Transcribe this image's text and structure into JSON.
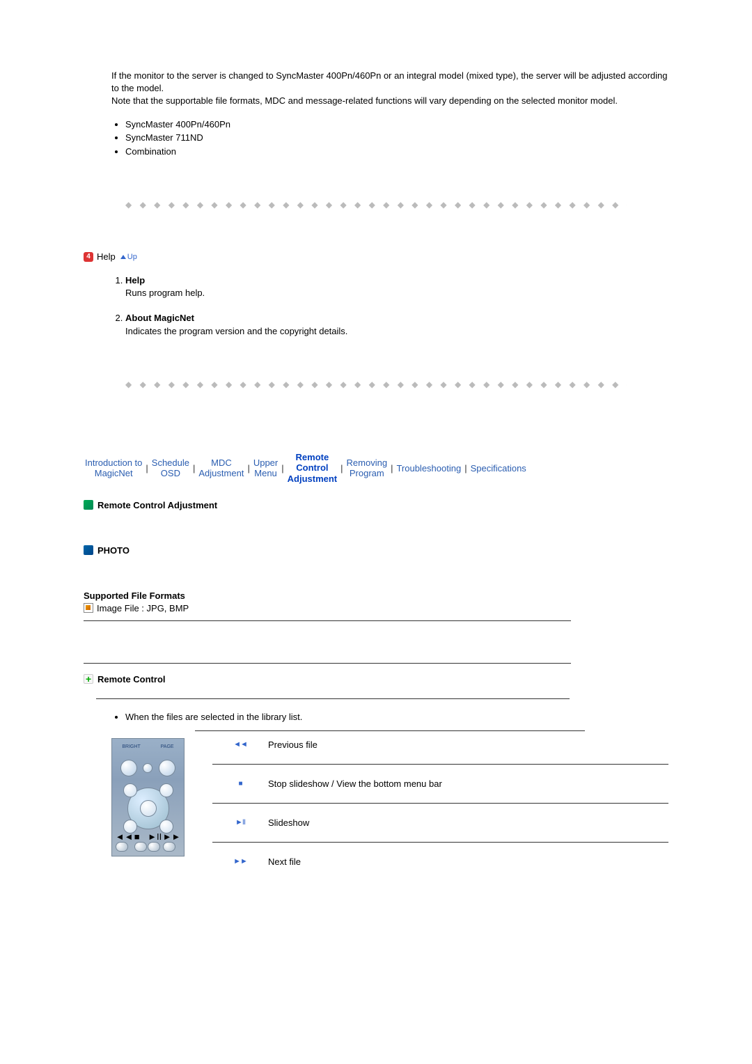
{
  "intro": {
    "paragraph": "If the monitor to the server is changed to SyncMaster 400Pn/460Pn or an integral model (mixed type), the server will be adjusted according to the model.\nNote that the supportable file formats, MDC and message-related functions will vary depending on the selected monitor model.",
    "bullets": [
      "SyncMaster 400Pn/460Pn",
      "SyncMaster 711ND",
      "Combination"
    ]
  },
  "help_section": {
    "icon_num": "4",
    "title": "Help",
    "up_label": "Up",
    "items": [
      {
        "title": "Help",
        "desc": "Runs program help."
      },
      {
        "title": "About MagicNet",
        "desc": "Indicates the program version and the copyright details."
      }
    ]
  },
  "nav": {
    "links": [
      {
        "line1": "Introduction to",
        "line2": "MagicNet"
      },
      {
        "line1": "Schedule",
        "line2": "OSD"
      },
      {
        "line1": "MDC",
        "line2": "Adjustment"
      },
      {
        "line1": "Upper",
        "line2": "Menu"
      },
      {
        "line1": "Remote",
        "line2": "Control",
        "line3": "Adjustment",
        "current": true
      },
      {
        "line1": "Removing",
        "line2": "Program"
      },
      {
        "line1": "Troubleshooting"
      },
      {
        "line1": "Specifications"
      }
    ]
  },
  "remote_section_title": "Remote Control Adjustment",
  "photo_title": "PHOTO",
  "supported": {
    "title": "Supported File Formats",
    "line": "Image File : JPG, BMP"
  },
  "remote_control": {
    "title": "Remote Control",
    "library_text": "When the files are selected in the library list.",
    "remote_labels": {
      "left": "BRIGHT",
      "right": "PAGE"
    },
    "bottom_syms": [
      "◄◄",
      "■",
      "►II",
      "►►"
    ],
    "rows": [
      {
        "icon": "◄◄",
        "label": "Previous file"
      },
      {
        "icon": "■",
        "label": "Stop slideshow / View the bottom menu bar"
      },
      {
        "icon": "►II",
        "label": "Slideshow"
      },
      {
        "icon": "►►",
        "label": "Next file"
      }
    ]
  }
}
